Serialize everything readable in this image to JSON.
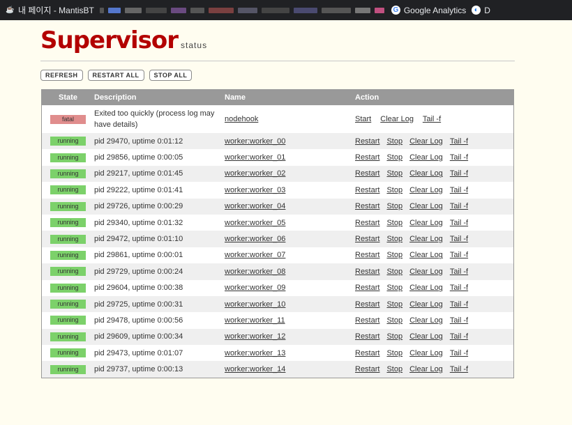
{
  "bookmarks": [
    {
      "icon": "java-icon",
      "label": "내 페이지 - MantisBT"
    },
    {
      "icon": "google-analytics-icon",
      "label": "Google Analytics"
    },
    {
      "icon": "bookmark-icon",
      "label": "D"
    }
  ],
  "header": {
    "title": "Supervisor",
    "subtitle": "status"
  },
  "toolbar": {
    "refresh": "REFRESH",
    "restart_all": "RESTART ALL",
    "stop_all": "STOP ALL"
  },
  "table": {
    "headers": {
      "state": "State",
      "description": "Description",
      "name": "Name",
      "action": "Action"
    },
    "fatal": {
      "state": "fatal",
      "description": "Exited too quickly (process log may have details)",
      "name": "nodehook",
      "actions": [
        "Start",
        "Clear Log",
        "Tail -f"
      ]
    },
    "running_actions": [
      "Restart",
      "Stop",
      "Clear Log",
      "Tail -f"
    ],
    "rows": [
      {
        "state": "running",
        "description": "pid 29470, uptime 0:01:12",
        "name": "worker:worker_00"
      },
      {
        "state": "running",
        "description": "pid 29856, uptime 0:00:05",
        "name": "worker:worker_01"
      },
      {
        "state": "running",
        "description": "pid 29217, uptime 0:01:45",
        "name": "worker:worker_02"
      },
      {
        "state": "running",
        "description": "pid 29222, uptime 0:01:41",
        "name": "worker:worker_03"
      },
      {
        "state": "running",
        "description": "pid 29726, uptime 0:00:29",
        "name": "worker:worker_04"
      },
      {
        "state": "running",
        "description": "pid 29340, uptime 0:01:32",
        "name": "worker:worker_05"
      },
      {
        "state": "running",
        "description": "pid 29472, uptime 0:01:10",
        "name": "worker:worker_06"
      },
      {
        "state": "running",
        "description": "pid 29861, uptime 0:00:01",
        "name": "worker:worker_07"
      },
      {
        "state": "running",
        "description": "pid 29729, uptime 0:00:24",
        "name": "worker:worker_08"
      },
      {
        "state": "running",
        "description": "pid 29604, uptime 0:00:38",
        "name": "worker:worker_09"
      },
      {
        "state": "running",
        "description": "pid 29725, uptime 0:00:31",
        "name": "worker:worker_10"
      },
      {
        "state": "running",
        "description": "pid 29478, uptime 0:00:56",
        "name": "worker:worker_11"
      },
      {
        "state": "running",
        "description": "pid 29609, uptime 0:00:34",
        "name": "worker:worker_12"
      },
      {
        "state": "running",
        "description": "pid 29473, uptime 0:01:07",
        "name": "worker:worker_13"
      },
      {
        "state": "running",
        "description": "pid 29737, uptime 0:00:13",
        "name": "worker:worker_14"
      }
    ]
  },
  "colors": {
    "running": "#7cd16a",
    "fatal": "#e08d8d",
    "logo": "#b30000",
    "header_bg": "#999999"
  }
}
